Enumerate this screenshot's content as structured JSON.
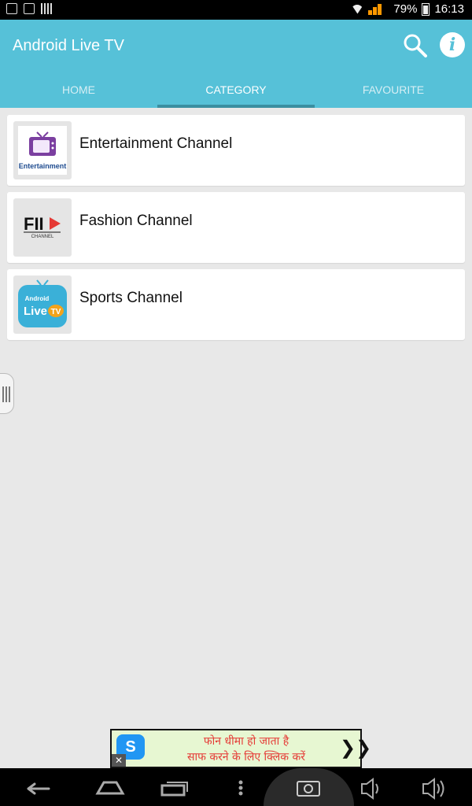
{
  "status_bar": {
    "battery": "79%",
    "time": "16:13",
    "icons": [
      "image-icon",
      "sd-card-icon",
      "barcode-icon",
      "wifi-icon",
      "signal-icon",
      "battery-icon"
    ]
  },
  "app_bar": {
    "title": "Android Live TV",
    "icons": [
      "search-icon",
      "info-icon"
    ],
    "info_glyph": "i",
    "color": "#56c1d8"
  },
  "tabs": [
    {
      "label": "HOME",
      "active": false
    },
    {
      "label": "CATEGORY",
      "active": true
    },
    {
      "label": "FAVOURITE",
      "active": false
    }
  ],
  "categories": [
    {
      "label": "Entertainment Channel",
      "thumb_text": "Entertainment"
    },
    {
      "label": "Fashion Channel",
      "thumb_text": "FII",
      "thumb_sub": "CHANNEL"
    },
    {
      "label": "Sports Channel",
      "thumb_text": "Android Live",
      "thumb_badge": "TV"
    }
  ],
  "ad": {
    "line1": "फोन धीमा हो जाता है",
    "line2": "साफ करने के लिए क्लिक करें",
    "arrow": "❯❯",
    "close": "✕",
    "logo": "S"
  },
  "nav_bar": {
    "icons": [
      "back-icon",
      "home-icon",
      "recents-icon",
      "menu-icon",
      "screenshot-icon",
      "volume-down-icon",
      "volume-up-icon"
    ]
  }
}
